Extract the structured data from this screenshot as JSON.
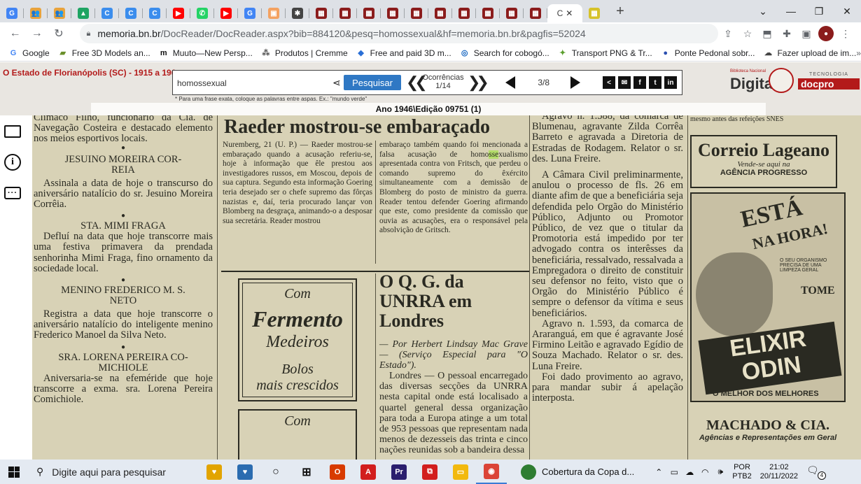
{
  "browser": {
    "tabs": [
      {
        "icon": "google-icon",
        "label": "G",
        "color": "#4285f4"
      },
      {
        "icon": "contacts-icon",
        "label": "👥",
        "color": "#e8a33d"
      },
      {
        "icon": "contacts-icon",
        "label": "👥",
        "color": "#e8a33d"
      },
      {
        "icon": "drive-icon",
        "label": "▲",
        "color": "#1fa463"
      },
      {
        "icon": "chrome-web-icon",
        "label": "C",
        "color": "#3b8ded"
      },
      {
        "icon": "chrome-web-icon",
        "label": "C",
        "color": "#3b8ded"
      },
      {
        "icon": "chrome-web-icon",
        "label": "C",
        "color": "#3b8ded"
      },
      {
        "icon": "youtube-icon",
        "label": "▶",
        "color": "#ff0000"
      },
      {
        "icon": "whatsapp-icon",
        "label": "✆",
        "color": "#25d366"
      },
      {
        "icon": "youtube-icon",
        "label": "▶",
        "color": "#ff0000"
      },
      {
        "icon": "google-icon",
        "label": "G",
        "color": "#4285f4"
      },
      {
        "icon": "image-icon",
        "label": "▣",
        "color": "#f4a261"
      },
      {
        "icon": "settings-tab-icon",
        "label": "✱",
        "color": "#444444"
      },
      {
        "icon": "library-icon",
        "label": "▦",
        "color": "#8b1c1c"
      },
      {
        "icon": "library-icon",
        "label": "▦",
        "color": "#8b1c1c"
      },
      {
        "icon": "library-icon",
        "label": "▦",
        "color": "#8b1c1c"
      },
      {
        "icon": "library-icon",
        "label": "▦",
        "color": "#8b1c1c"
      },
      {
        "icon": "library-icon",
        "label": "▦",
        "color": "#8b1c1c"
      },
      {
        "icon": "library-icon",
        "label": "▦",
        "color": "#8b1c1c"
      },
      {
        "icon": "library-icon",
        "label": "▦",
        "color": "#8b1c1c"
      },
      {
        "icon": "library-icon",
        "label": "▦",
        "color": "#8b1c1c"
      },
      {
        "icon": "library-icon",
        "label": "▦",
        "color": "#8b1c1c"
      },
      {
        "icon": "library-icon",
        "label": "▦",
        "color": "#8b1c1c"
      }
    ],
    "active_tab_label": "C",
    "last_tab": {
      "icon": "image-icon",
      "label": "▦",
      "color": "#d6c22a"
    },
    "new_tab": "+",
    "window_controls": [
      "⌄",
      "—",
      "❐",
      "✕"
    ],
    "url_host": "memoria.bn.br",
    "url_path": "/DocReader/DocReader.aspx?bib=884120&pesq=homossexual&hf=memoria.bn.br&pagfis=52024",
    "bookmarks": [
      {
        "label": "Google",
        "icon": "google-icon",
        "glyph": "G",
        "color": "#4285f4"
      },
      {
        "label": "Free 3D Models an...",
        "icon": "models-icon",
        "glyph": "▰",
        "color": "#6a8f2a"
      },
      {
        "label": "Muuto—New Persp...",
        "icon": "muuto-icon",
        "glyph": "m",
        "color": "#111111"
      },
      {
        "label": "Produtos | Cremme",
        "icon": "cremme-icon",
        "glyph": "⁂",
        "color": "#555555"
      },
      {
        "label": "Free and paid 3D m...",
        "icon": "3d-icon",
        "glyph": "◆",
        "color": "#2a6fd6"
      },
      {
        "label": "Search for cobogó...",
        "icon": "search-site-icon",
        "glyph": "◎",
        "color": "#1565c0"
      },
      {
        "label": "Transport PNG & Tr...",
        "icon": "png-icon",
        "glyph": "✦",
        "color": "#5a9e2c"
      },
      {
        "label": "Ponte Pedonal sobr...",
        "icon": "ponte-icon",
        "glyph": "●",
        "color": "#2a4fb0"
      },
      {
        "label": "Fazer upload de im...",
        "icon": "upload-icon",
        "glyph": "☁",
        "color": "#444444"
      }
    ],
    "bookmarks_more": "»"
  },
  "viewer": {
    "publication_title": "O Estado de Florianópolis (SC) - 1915 a 196",
    "search_value": "homossexual",
    "search_button": "Pesquisar",
    "occurrences_label": "Ocorrências",
    "occurrences_value": "1/14",
    "page_value": "3/8",
    "hint": "* Para uma frase exata, coloque as palavras entre aspas. Ex.: \"mundo verde\"",
    "edition": "Ano 1946\\Edição 09751 (1)",
    "logo_digital": "Digital",
    "logo_small": "Biblioteca Nacional",
    "logo_tec": "TECNOLOGIA",
    "logo_docpro": "docpro",
    "social": [
      "<",
      "✉",
      "f",
      "t",
      "in"
    ]
  },
  "newspaper": {
    "col1": {
      "p1": "Climaco Filho, funcionário da Cia. de Navegação Costeira e destacado elemento nos meios esportivos locais.",
      "h1": "JESUINO MOREIRA COR-\nREIA",
      "p2": "Assinala a data de hoje o transcurso do aniversário natalício do sr. Jesuino Moreira Corrêia.",
      "h2": "STA. MIMI FRAGA",
      "p3": "Defluí na data que hoje transcorre mais uma festiva primavera da prendada senhorinha Mimi Fraga, fino ornamento da sociedade local.",
      "h3": "MENINO FREDERICO M. S.\nNETO",
      "p4": "Registra a data que hoje transcorre o aniversário natalício do inteligente menino Frederico Manoel da Silva Neto.",
      "h4": "SRA. LORENA PEREIRA CO-\nMICHIOLE",
      "p5": "Aniversaria-se na efeméride que hoje transcorre a exma. sra. Lorena Pereira Comichiole."
    },
    "raeder": {
      "headline": "Raeder mostrou-se embaraçado",
      "left": "Nuremberg, 21 (U. P.) — Raeder mostrou-se embaraçado quando a acusação referiu-se, hoje à informação que êle prestou aos investigadores russos, em Moscou, depois de sua captura. Segundo esta informação Goering teria desejado ser o chefe supremo das fôrças nazistas e, daí, teria procurado lançar von Blomberg na desgraça, animando-o a desposar sua secretária. Reader mostrou",
      "right_pre": "embaraço também quando foi mencionada a falsa acusação de ",
      "right_hl_a": "homo",
      "right_hl": "sse",
      "right_post": "xualismo apresentada contra von Fritsch, que perdeu o comando supremo do êxército simultaneamente com a demissão de Blomberg do posto de ministro da guerra. Reader tentou defender Goering afirmando que este, como presidente da comissão que ouvia as acusações, era o responsável pela absolvição de Gritsch."
    },
    "fermento": {
      "com": "Com",
      "brand1": "Fermento",
      "brand2": "Medeiros",
      "bolos": "Bolos",
      "mais": "mais crescidos",
      "com2": "Com"
    },
    "unrra": {
      "headline": "O Q. G. da UNRRA em Londres",
      "byline": "— Por Herbert Lindsay Mac Grave — (Serviço Especial para \"O Estado\").",
      "body": "Londres — O pessoal encarregado das diversas secções da UNRRA nesta capital onde está localisado a quartel general dessa organização para toda a Europa atinge a um total de 953 pessoas que representam nada menos de dezesseis das trinta e cinco nações reunidas sob a bandeira dessa"
    },
    "col3": {
      "p1": "Agravo n. 1.588, da comarca de Blumenau, agravante Zilda Corrêa Barreto e agravada a Diretoria de Estradas de Rodagem. Relator o sr. des. Luna Freire.",
      "p2": "A Câmara Civil preliminarmente, anulou o processo de fls. 26 em diante afim de que a beneficiária seja defendida pelo Orgão do Ministério Público, Adjunto ou Promotor Público, de vez que o titular da Promotoria está impedido por ter advogado contra os interêsses da beneficiária, ressalvado, ressalvada a Empregadora o direito de constituir seu defensor no feito, visto que o Orgão do Ministério Público é sempre o defensor da vítima e seus beneficiários.",
      "p3": "Agravo n. 1.593, da comarca de Araranguá, em que é agravante José Firmino Leitão e agravado Egídio de Souza Machado. Relator o sr. des. Luna Freire.",
      "p4": "Foi dado provimento ao agravo, para mandar subir á apelação interposta."
    },
    "col4": {
      "top": "mesmo antes das refeições SNES",
      "correio": "Correio Lageano",
      "vende": "Vende-se aqui na",
      "agencia": "AGÊNCIA PROGRESSO",
      "esta": "ESTÁ",
      "nahora": "NA HORA!",
      "desc": "O SEU ORGANISMO PRECISA DE UMA LIMPEZA GERAL",
      "tome": "TOME",
      "elixir": "ELIXIR ODIN",
      "melhor": "O MELHOR DOS MELHORES",
      "machado": "MACHADO & CIA.",
      "agencias": "Agências e Representações em Geral"
    }
  },
  "taskbar": {
    "search_placeholder": "Digite aqui para pesquisar",
    "apps": [
      {
        "icon": "widgets-icon",
        "glyph": "♥",
        "color": "#e2a400"
      },
      {
        "icon": "widgets2-icon",
        "glyph": "♥",
        "color": "#2b6cb0"
      },
      {
        "icon": "cortana-icon",
        "glyph": "○",
        "color": "transparent"
      },
      {
        "icon": "task-view-icon",
        "glyph": "⊞",
        "color": "transparent"
      },
      {
        "icon": "office-icon",
        "glyph": "O",
        "color": "#d83b01"
      },
      {
        "icon": "acrobat-icon",
        "glyph": "A",
        "color": "#d21e1e"
      },
      {
        "icon": "premiere-icon",
        "glyph": "Pr",
        "color": "#2a1f6e"
      },
      {
        "icon": "pdf-icon",
        "glyph": "⧉",
        "color": "#d21e1e"
      },
      {
        "icon": "explorer-icon",
        "glyph": "▭",
        "color": "#f2b90f"
      },
      {
        "icon": "chrome-icon",
        "glyph": "◉",
        "color": "#db4437"
      }
    ],
    "weather_text": "Cobertura da Copa d...",
    "lang": "POR",
    "lang2": "PTB2",
    "time": "21:02",
    "date": "20/11/2022",
    "notifications": "4"
  }
}
